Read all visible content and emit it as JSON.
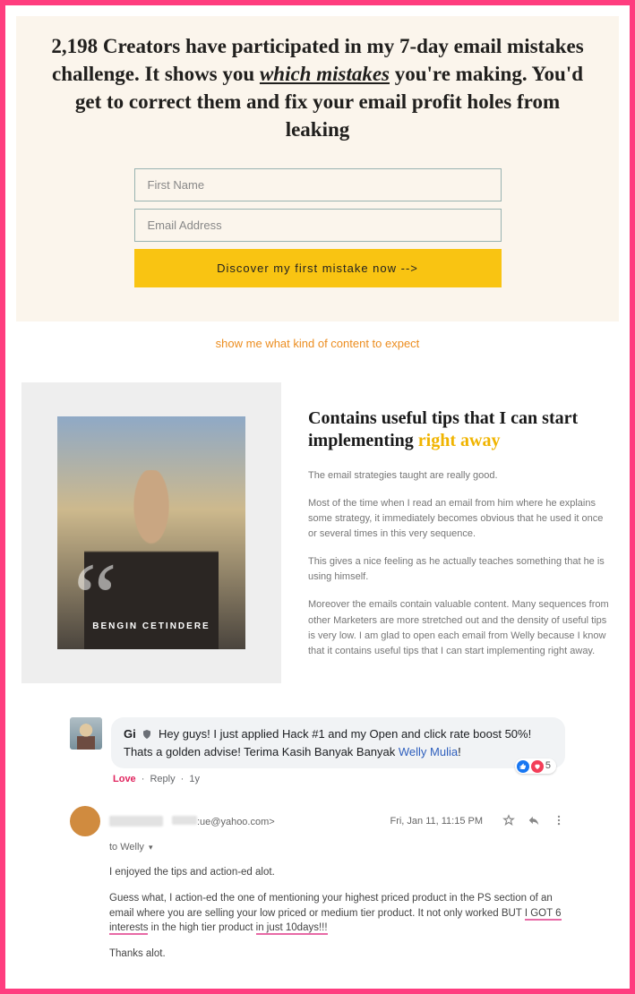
{
  "hero": {
    "headline_parts": {
      "p1": "2,198 Creators have participated in my 7-day email mistakes challenge. It shows you ",
      "underlined": "which mistakes",
      "p2": " you're making. You'd get to correct them and fix your email profit holes from leaking"
    },
    "first_name_placeholder": "First Name",
    "email_placeholder": "Email Address",
    "cta_label": "Discover my first mistake now -->"
  },
  "expect_link_text": "show me what kind of content to expect",
  "testimonial": {
    "photo_name": "BENGIN CETINDERE",
    "headline_p1": "Contains useful tips that I can start implementing ",
    "headline_accent": "right away",
    "paras": [
      "The email strategies taught are really good.",
      "Most of the time when I read an email from him where he explains some strategy, it immediately becomes obvious that he used it once or several times in this very sequence.",
      "This gives a nice feeling as he actually teaches something that he is using himself.",
      "Moreover the emails contain valuable content. Many sequences from other Marketers are more stretched out and the density of useful tips is very low. I am glad to open each email from Welly because I know that it contains useful tips that I can start implementing right away."
    ]
  },
  "fb_comment": {
    "commenter_name": "Gi",
    "body_pre": " Hey guys! I just applied Hack #1 and my Open and click rate boost 50%! Thats a golden advise! Terima Kasih Banyak Banyak ",
    "mention": "Welly Mulia",
    "body_post": "!",
    "react_count": "5",
    "meta": {
      "love": "Love",
      "reply": "Reply",
      "age": "1y"
    }
  },
  "email": {
    "addr_suffix": ":ue@yahoo.com>",
    "date": "Fri, Jan 11, 11:15 PM",
    "to_line": "to Welly",
    "p1": "I enjoyed the tips and action-ed alot.",
    "p2_pre": "Guess what, I action-ed the one of mentioning your highest priced product in the PS section of an email where you are selling your low priced or medium tier product. It not only worked BUT ",
    "p2_hl1": "I GOT 6 interests",
    "p2_mid": " in the high tier product ",
    "p2_hl2": "in just 10days!!!",
    "p3": "Thanks alot."
  }
}
